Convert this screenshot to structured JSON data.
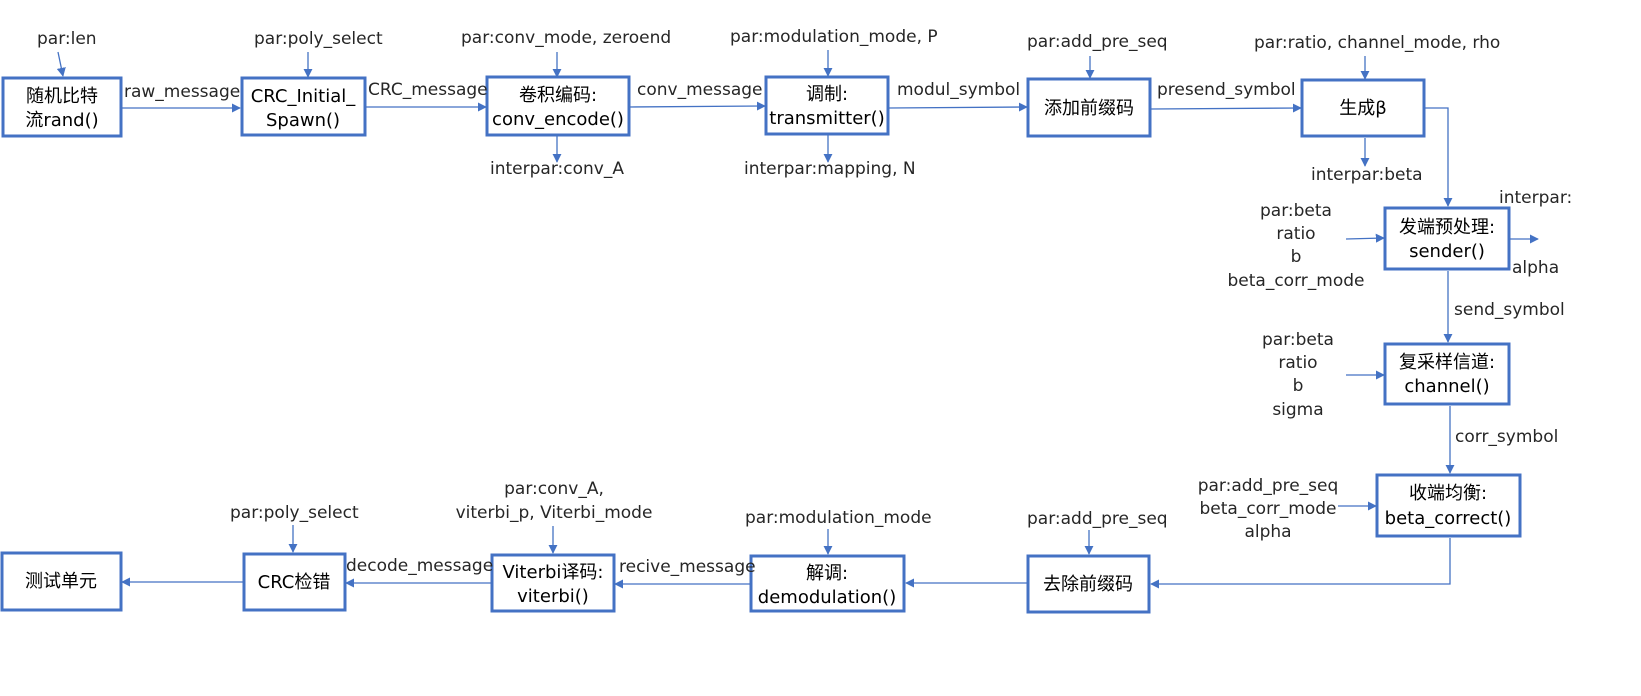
{
  "colors": {
    "stroke": "#4472c4",
    "text": "#262626"
  },
  "nodes": {
    "rand": [
      "随机比特",
      "流rand()"
    ],
    "crc_spawn": [
      "CRC_Initial_",
      "Spawn()"
    ],
    "conv": [
      "卷积编码:",
      "conv_encode()"
    ],
    "mod": [
      "调制:",
      "transmitter()"
    ],
    "addpre": [
      "添加前缀码"
    ],
    "beta": [
      "生成β"
    ],
    "sender": [
      "发端预处理:",
      "sender()"
    ],
    "channel": [
      "复采样信道:",
      "channel()"
    ],
    "beta_correct": [
      "收端均衡:",
      "beta_correct()"
    ],
    "rmpre": [
      "去除前缀码"
    ],
    "demod": [
      "解调:",
      "demodulation()"
    ],
    "viterbi": [
      "Viterbi译码:",
      "viterbi()"
    ],
    "crc_check": [
      "CRC检错"
    ],
    "test": [
      "测试单元"
    ]
  },
  "edges": {
    "raw_message": "raw_message",
    "crc_message": "CRC_message",
    "conv_message": "conv_message",
    "modul_symbol": "modul_symbol",
    "presend_symbol": "presend_symbol",
    "send_symbol": "send_symbol",
    "corr_symbol": "corr_symbol",
    "recive_message": "recive_message",
    "decode_message": "decode_message"
  },
  "params": {
    "len": [
      "par:len"
    ],
    "poly_select_top": [
      "par:poly_select"
    ],
    "conv_mode": [
      "par:conv_mode, zeroend"
    ],
    "modulation_top": [
      "par:modulation_mode, P"
    ],
    "add_pre_seq_top": [
      "par:add_pre_seq"
    ],
    "ratio_channel": [
      "par:ratio, channel_mode, rho"
    ],
    "sender_params": [
      "par:beta",
      "ratio",
      "b",
      "beta_corr_mode"
    ],
    "channel_params": [
      "par:beta",
      "ratio",
      "b",
      "sigma"
    ],
    "beta_correct_params": [
      "par:add_pre_seq",
      "beta_corr_mode",
      "alpha"
    ],
    "add_pre_seq_bottom": [
      "par:add_pre_seq"
    ],
    "modulation_bottom": [
      "par:modulation_mode"
    ],
    "viterbi_params": [
      "par:conv_A,",
      "viterbi_p, Viterbi_mode"
    ],
    "poly_select_bottom": [
      "par:poly_select"
    ]
  },
  "outputs": {
    "conv_A": [
      "interpar:conv_A"
    ],
    "mapping": [
      "interpar:mapping, N"
    ],
    "beta": [
      "interpar:beta"
    ],
    "sender_out": [
      "interpar:"
    ],
    "alpha": [
      "alpha"
    ]
  }
}
